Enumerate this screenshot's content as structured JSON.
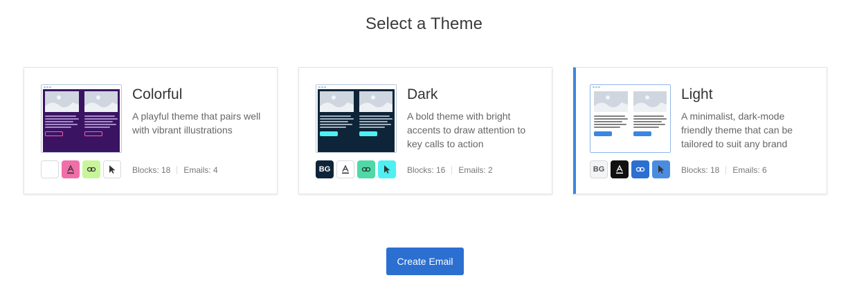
{
  "page": {
    "title": "Select a Theme"
  },
  "themes": [
    {
      "name": "Colorful",
      "description": "A playful theme that pairs well with vibrant illustrations",
      "blocks": "Blocks: 18",
      "emails": "Emails: 4",
      "selected": false,
      "preview": {
        "bg": "#3a1463",
        "text": "#cdb3ee",
        "button": "#ff5fa2",
        "placeholder": "#cfd6df"
      },
      "swatches": [
        {
          "kind": "bg",
          "label": "",
          "bg": "#ffffff",
          "fg": "#333333"
        },
        {
          "kind": "text",
          "icon": "text-color-icon",
          "bg": "#f06ea9",
          "fg": "#333333"
        },
        {
          "kind": "link",
          "icon": "link-icon",
          "bg": "#c9f59a",
          "fg": "#333333"
        },
        {
          "kind": "button",
          "icon": "cursor-icon",
          "bg": "#ffffff",
          "fg": "#333333"
        }
      ]
    },
    {
      "name": "Dark",
      "description": "A bold theme with bright accents to draw attention to key calls to action",
      "blocks": "Blocks: 16",
      "emails": "Emails: 2",
      "selected": false,
      "preview": {
        "bg": "#0e2438",
        "text": "#d6e2ee",
        "button": "#4ff0f2",
        "placeholder": "#cfd6df"
      },
      "swatches": [
        {
          "kind": "bg",
          "label": "BG",
          "bg": "#0e2438",
          "fg": "#ffffff"
        },
        {
          "kind": "text",
          "icon": "text-color-icon",
          "bg": "#ffffff",
          "fg": "#333333"
        },
        {
          "kind": "link",
          "icon": "link-icon",
          "bg": "#4fd9a6",
          "fg": "#333333"
        },
        {
          "kind": "button",
          "icon": "cursor-icon",
          "bg": "#4ff0f2",
          "fg": "#333333"
        }
      ]
    },
    {
      "name": "Light",
      "description": "A minimalist, dark-mode friendly theme that can be tailored to suit any brand",
      "blocks": "Blocks: 18",
      "emails": "Emails: 6",
      "selected": true,
      "preview": {
        "bg": "#ffffff",
        "text": "#555555",
        "button": "#3b86e0",
        "placeholder": "#cfd6df"
      },
      "swatches": [
        {
          "kind": "bg",
          "label": "BG",
          "bg": "#f3f4f6",
          "fg": "#555555"
        },
        {
          "kind": "text",
          "icon": "text-color-icon",
          "bg": "#111111",
          "fg": "#ffffff"
        },
        {
          "kind": "link",
          "icon": "link-icon",
          "bg": "#2b6fd1",
          "fg": "#ffffff"
        },
        {
          "kind": "button",
          "icon": "cursor-icon",
          "bg": "#4a8de0",
          "fg": "#333333"
        }
      ]
    }
  ],
  "actions": {
    "create_label": "Create Email"
  },
  "colors": {
    "accent": "#2b6fd1",
    "selected_border": "#3b86e0"
  }
}
